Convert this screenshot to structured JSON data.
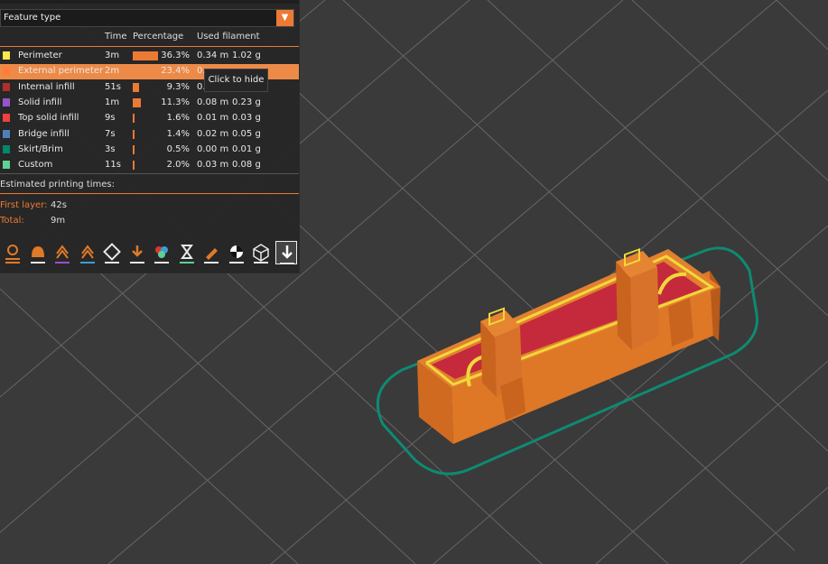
{
  "combo": {
    "label": "Feature type"
  },
  "columns": {
    "time": "Time",
    "percentage": "Percentage",
    "used": "Used filament"
  },
  "rows": [
    {
      "name": "Perimeter",
      "time": "3m",
      "pct": "36.3%",
      "pct_value": 36.3,
      "length": "0.34 m",
      "weight": "1.02 g",
      "color": "#ffe64d"
    },
    {
      "name": "External perimeter",
      "time": "2m",
      "pct": "23.4%",
      "pct_value": 23.4,
      "length": "0.",
      "weight": "",
      "color": "#ff7d38"
    },
    {
      "name": "Internal infill",
      "time": "51s",
      "pct": "9.3%",
      "pct_value": 9.3,
      "length": "0.",
      "weight": "",
      "color": "#b03029"
    },
    {
      "name": "Solid infill",
      "time": "1m",
      "pct": "11.3%",
      "pct_value": 11.3,
      "length": "0.08 m",
      "weight": "0.23 g",
      "color": "#9654cc"
    },
    {
      "name": "Top solid infill",
      "time": "9s",
      "pct": "1.6%",
      "pct_value": 1.6,
      "length": "0.01 m",
      "weight": "0.03 g",
      "color": "#f04040"
    },
    {
      "name": "Bridge infill",
      "time": "7s",
      "pct": "1.4%",
      "pct_value": 1.4,
      "length": "0.02 m",
      "weight": "0.05 g",
      "color": "#4d80ba"
    },
    {
      "name": "Skirt/Brim",
      "time": "3s",
      "pct": "0.5%",
      "pct_value": 0.5,
      "length": "0.00 m",
      "weight": "0.01 g",
      "color": "#00876e"
    },
    {
      "name": "Custom",
      "time": "11s",
      "pct": "2.0%",
      "pct_value": 2.0,
      "length": "0.03 m",
      "weight": "0.08 g",
      "color": "#5ed194"
    }
  ],
  "tooltip": "Click to hide",
  "estimated": {
    "label": "Estimated printing times:",
    "first_layer_label": "First layer:",
    "first_layer_value": "42s",
    "total_label": "Total:",
    "total_value": "9m"
  },
  "toolbar": [
    "travel-icon",
    "retractions-icon",
    "unretractions-icon",
    "seams-icon",
    "tool-changes-icon",
    "color-changes-icon",
    "pause-icon",
    "custom-gcode-icon",
    "sequential-icon",
    "shells-icon",
    "tool-marker-icon",
    "legend-icon"
  ],
  "colors": {
    "accent": "#eb7a35",
    "background": "#3a3a3a",
    "panel": "#262626",
    "print_orange": "#e07a28",
    "print_red": "#c42a3b",
    "print_yellow": "#f2d83a",
    "skirt": "#0e8a72"
  }
}
